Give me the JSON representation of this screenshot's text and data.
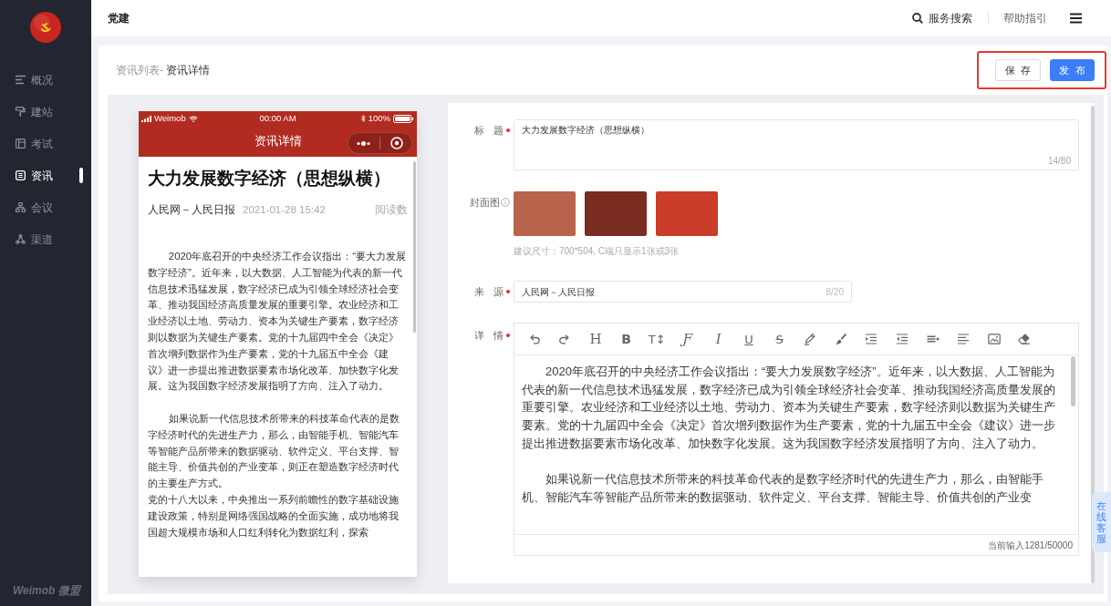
{
  "sidebar": {
    "items": [
      {
        "label": "概况",
        "selected": false
      },
      {
        "label": "建站",
        "selected": false
      },
      {
        "label": "考试",
        "selected": false
      },
      {
        "label": "资讯",
        "selected": true
      },
      {
        "label": "会议",
        "selected": false
      },
      {
        "label": "渠道",
        "selected": false
      }
    ],
    "brand": "Weimob 微盟"
  },
  "topbar": {
    "title": "党建",
    "search": "服务搜索",
    "help": "帮助指引"
  },
  "header": {
    "breadcrumb": {
      "parent": "资讯列表-",
      "current": "资讯详情"
    },
    "buttons": [
      {
        "label": "保 存",
        "kind": "default"
      },
      {
        "label": "发 布",
        "kind": "primary"
      }
    ]
  },
  "phone": {
    "status": {
      "carrier": "Weimob",
      "time": "00:00 AM",
      "battery": "100%"
    },
    "nav_title": "资讯详情",
    "article": {
      "title": "大力发展数字经济（思想纵横）",
      "source": "人民网－人民日报",
      "date": "2021-01-28 15:42",
      "reads": "阅读数",
      "blocks": [
        {
          "kind": "para",
          "indent": true,
          "text": "2020年底召开的中央经济工作会议指出：“要大力发展数字经济”。近年来，以大数据、人工智能为代表的新一代信息技术迅猛发展，数字经济已成为引领全球经济社会变革、推动我国经济高质量发展的重要引擎。农业经济和工业经济以土地、劳动力、资本为关键生产要素，数字经济则以数据为关键生产要素。党的十九届四中全会《决定》首次增列数据作为生产要素，党的十九届五中全会《建议》进一步提出推进数据要素市场化改革、加快数字化发展。这为我国数字经济发展指明了方向、注入了动力。"
        },
        {
          "kind": "blank"
        },
        {
          "kind": "para",
          "indent": true,
          "text": "如果说新一代信息技术所带来的科技革命代表的是数字经济时代的先进生产力，那么，由智能手机、智能汽车等智能产品所带来的数据驱动、软件定义、平台支撑、智能主导、价值共创的产业变革，则正在塑造数字经济时代的主要生产方式。"
        },
        {
          "kind": "para",
          "indent": false,
          "text": "党的十八大以来，中央推出一系列前瞻性的数字基础设施建设政策，特别是网络强国战略的全面实施，成功地将我国超大规模市场和人口红利转化为数据红利，探索"
        }
      ]
    }
  },
  "form": {
    "fields": [
      {
        "kind": "textarea",
        "label": "标 题",
        "required": true,
        "info": false,
        "value": "大力发展数字经济（思想纵横）",
        "counter": "14/80"
      },
      {
        "kind": "covers",
        "label": "封面图",
        "required": false,
        "info": true,
        "covers": [
          {
            "color": "#b8634c"
          },
          {
            "color": "#7a2c20"
          },
          {
            "color": "#c93d2a"
          }
        ],
        "hint": "建议尺寸：700*504, C端只显示1张或3张"
      },
      {
        "kind": "input",
        "label": "来 源",
        "required": true,
        "info": false,
        "value": "人民网－人民日报",
        "counter": "8/20"
      },
      {
        "kind": "editor",
        "label": "详 情",
        "required": true,
        "info": false,
        "toolbar": [
          {
            "kind": "icon"
          },
          {
            "kind": "icon"
          },
          {
            "kind": "serif",
            "text": "H"
          },
          {
            "kind": "bold",
            "text": "B"
          },
          {
            "kind": "plain",
            "text": "T↕"
          },
          {
            "kind": "script",
            "text": "Ƒ"
          },
          {
            "kind": "italic",
            "text": "I"
          },
          {
            "kind": "underline",
            "text": "U"
          },
          {
            "kind": "strike",
            "text": "S"
          },
          {
            "kind": "icon"
          },
          {
            "kind": "icon"
          },
          {
            "kind": "icon"
          },
          {
            "kind": "icon"
          },
          {
            "kind": "icon"
          },
          {
            "kind": "icon"
          },
          {
            "kind": "icon"
          },
          {
            "kind": "icon"
          }
        ],
        "blocks": [
          {
            "kind": "para",
            "indent": true,
            "text": "2020年底召开的中央经济工作会议指出：“要大力发展数字经济”。近年来，以大数据、人工智能为代表的新一代信息技术迅猛发展，数字经济已成为引领全球经济社会变革、推动我国经济高质量发展的重要引擎。农业经济和工业经济以土地、劳动力、资本为关键生产要素，数字经济则以数据为关键生产要素。党的十九届四中全会《决定》首次增列数据作为生产要素，党的十九届五中全会《建议》进一步提出推进数据要素市场化改革、加快数字化发展。这为我国数字经济发展指明了方向、注入了动力。"
          },
          {
            "kind": "blank"
          },
          {
            "kind": "para",
            "indent": true,
            "text": "如果说新一代信息技术所带来的科技革命代表的是数字经济时代的先进生产力，那么，由智能手机、智能汽车等智能产品所带来的数据驱动、软件定义、平台支撑、智能主导、价值共创的产业变"
          }
        ],
        "counter": "当前输入1281/50000"
      }
    ]
  },
  "service_tab": "在线客服"
}
